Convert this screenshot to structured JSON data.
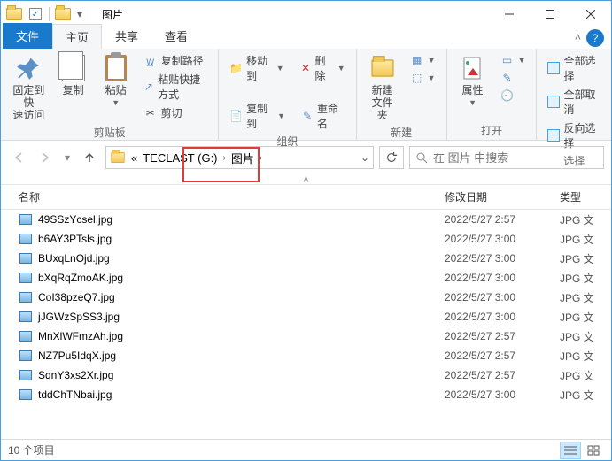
{
  "window": {
    "title": "图片"
  },
  "tabs": {
    "file": "文件",
    "home": "主页",
    "share": "共享",
    "view": "查看"
  },
  "ribbon": {
    "clipboard": {
      "pin": "固定到快\n速访问",
      "copy": "复制",
      "paste": "粘贴",
      "copy_path": "复制路径",
      "paste_shortcut": "粘贴快捷方式",
      "cut": "剪切",
      "group": "剪贴板"
    },
    "organize": {
      "move_to": "移动到",
      "copy_to": "复制到",
      "delete": "删除",
      "rename": "重命名",
      "group": "组织"
    },
    "new": {
      "new_folder": "新建\n文件夹",
      "group": "新建"
    },
    "open": {
      "properties": "属性",
      "group": "打开"
    },
    "select": {
      "select_all": "全部选择",
      "select_none": "全部取消",
      "invert": "反向选择",
      "group": "选择"
    }
  },
  "breadcrumb": {
    "prefix": "«",
    "seg1": "TECLAST (G:)",
    "seg2": "图片"
  },
  "search": {
    "placeholder": "在 图片 中搜索"
  },
  "columns": {
    "name": "名称",
    "date": "修改日期",
    "type": "类型"
  },
  "files": [
    {
      "name": "49SSzYcsel.jpg",
      "date": "2022/5/27 2:57",
      "type": "JPG 文"
    },
    {
      "name": "b6AY3PTsls.jpg",
      "date": "2022/5/27 3:00",
      "type": "JPG 文"
    },
    {
      "name": "BUxqLnOjd.jpg",
      "date": "2022/5/27 3:00",
      "type": "JPG 文"
    },
    {
      "name": "bXqRqZmoAK.jpg",
      "date": "2022/5/27 3:00",
      "type": "JPG 文"
    },
    {
      "name": "CoI38pzeQ7.jpg",
      "date": "2022/5/27 3:00",
      "type": "JPG 文"
    },
    {
      "name": "jJGWzSpSS3.jpg",
      "date": "2022/5/27 3:00",
      "type": "JPG 文"
    },
    {
      "name": "MnXlWFmzAh.jpg",
      "date": "2022/5/27 2:57",
      "type": "JPG 文"
    },
    {
      "name": "NZ7Pu5IdqX.jpg",
      "date": "2022/5/27 2:57",
      "type": "JPG 文"
    },
    {
      "name": "SqnY3xs2Xr.jpg",
      "date": "2022/5/27 2:57",
      "type": "JPG 文"
    },
    {
      "name": "tddChTNbai.jpg",
      "date": "2022/5/27 3:00",
      "type": "JPG 文"
    }
  ],
  "status": {
    "count": "10 个项目"
  }
}
